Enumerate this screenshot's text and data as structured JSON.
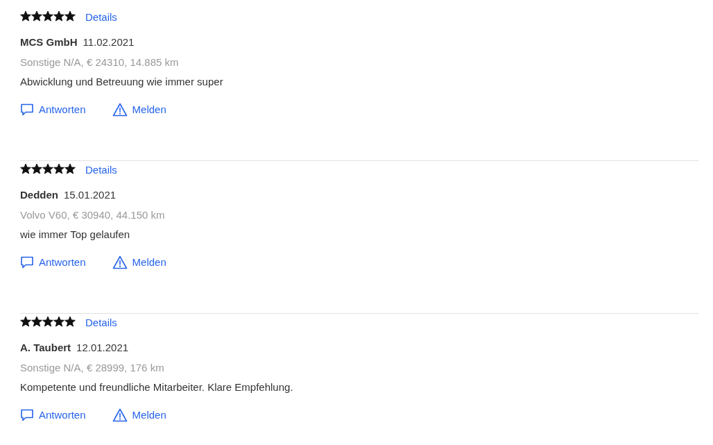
{
  "reviews": [
    {
      "stars": 5,
      "details": "Details",
      "author": "MCS GmbH",
      "date": "11.02.2021",
      "vehicle": "Sonstige N/A, € 24310, 14.885 km",
      "text": "Abwicklung und Betreuung wie immer super",
      "actions": [
        "Antworten",
        "Melden"
      ]
    },
    {
      "stars": 5,
      "details": "Details",
      "author": "Dedden",
      "date": "15.01.2021",
      "vehicle": "Volvo V60, € 30940, 44.150 km",
      "text": "wie immer Top gelaufen",
      "actions": [
        "Antworten",
        "Melden"
      ]
    },
    {
      "stars": 5,
      "details": "Details",
      "author": "A. Taubert",
      "date": "12.01.2021",
      "vehicle": "Sonstige N/A, € 28999, 176 km",
      "text": "Kompetente und freundliche Mitarbeiter. Klare Empfehlung.",
      "actions": [
        "Antworten",
        "Melden"
      ]
    }
  ]
}
